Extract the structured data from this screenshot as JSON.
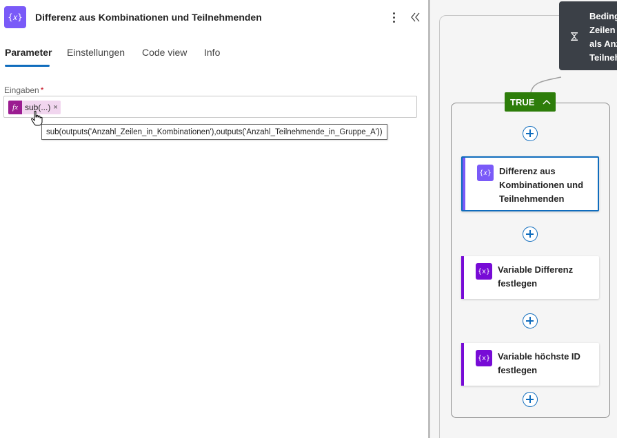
{
  "panel": {
    "title": "Differenz aus Kombinationen und Teilnehmenden",
    "action_icon_glyph": "{𝑥}",
    "tabs": [
      {
        "label": "Parameter",
        "active": true
      },
      {
        "label": "Einstellungen",
        "active": false
      },
      {
        "label": "Code view",
        "active": false
      },
      {
        "label": "Info",
        "active": false
      }
    ],
    "field": {
      "label": "Eingaben",
      "required_mark": "*",
      "token_icon": "fx",
      "token_text": "sub(...)",
      "token_remove": "×",
      "tooltip": "sub(outputs('Anzahl_Zeilen_in_Kombinationen'),outputs('Anzahl_Teilnehmende_in_Gruppe_A'))"
    }
  },
  "canvas": {
    "condition_lines": [
      "Beding",
      "Zeilen",
      "als Anz",
      "Teilneh"
    ],
    "true_label": "TRUE",
    "steps": [
      {
        "title": "Differenz aus Kombinationen und Teilnehmenden",
        "icon_glyph": "{𝑥}",
        "icon_color": "#7a5af8",
        "accent": "#7a5af8",
        "selected": true
      },
      {
        "title": "Variable Differenz festlegen",
        "icon_glyph": "{x}",
        "icon_color": "#770bd6",
        "accent": "#770bd6",
        "selected": false
      },
      {
        "title": "Variable höchste ID festlegen",
        "icon_glyph": "{x}",
        "icon_color": "#770bd6",
        "accent": "#770bd6",
        "selected": false
      }
    ]
  },
  "colors": {
    "primary": "#0f6cbd",
    "true_green": "#2d7d0a",
    "condition_bg": "#3b4047",
    "compose_purple": "#7a5af8",
    "variable_purple": "#770bd6",
    "expression_magenta": "#9b1c91"
  }
}
